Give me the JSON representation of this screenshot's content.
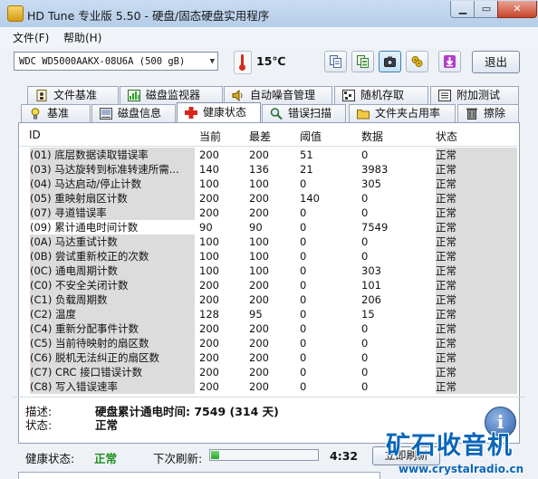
{
  "window": {
    "title": "HD Tune 专业版 5.50 - 硬盘/固态硬盘实用程序"
  },
  "menu": [
    {
      "label": "文件(F)"
    },
    {
      "label": "帮助(H)"
    }
  ],
  "toolbar": {
    "drive": "WDC WD5000AAKX-08U6A (500 gB)",
    "temperature": "15℃",
    "exit_label": "退出",
    "buttons": [
      "copy-icon",
      "copy-text-icon",
      "camera-icon",
      "options-icon",
      "download-icon"
    ]
  },
  "tabs_row1": [
    {
      "label": "文件基准",
      "icon": "file-benchmark-icon"
    },
    {
      "label": "磁盘监视器",
      "icon": "disk-monitor-icon"
    },
    {
      "label": "自动噪音管理",
      "icon": "speaker-icon"
    },
    {
      "label": "随机存取",
      "icon": "random-access-icon"
    },
    {
      "label": "附加测试",
      "icon": "extra-tests-icon"
    }
  ],
  "tabs_row2": [
    {
      "label": "基准",
      "icon": "benchmark-icon"
    },
    {
      "label": "磁盘信息",
      "icon": "disk-info-icon"
    },
    {
      "label": "健康状态",
      "icon": "health-cross-icon"
    },
    {
      "label": "错误扫描",
      "icon": "magnifier-icon"
    },
    {
      "label": "文件夹占用率",
      "icon": "folder-icon"
    },
    {
      "label": "擦除",
      "icon": "trash-icon"
    }
  ],
  "table": {
    "headers": {
      "id": "ID",
      "current": "当前",
      "worst": "最差",
      "threshold": "阈值",
      "data": "数据",
      "status": "状态"
    },
    "rows": [
      {
        "id": "(01) 底层数据读取错误率",
        "current": "200",
        "worst": "200",
        "threshold": "51",
        "data": "0",
        "status": "正常"
      },
      {
        "id": "(03) 马达旋转到标准转速所需...",
        "current": "140",
        "worst": "136",
        "threshold": "21",
        "data": "3983",
        "status": "正常"
      },
      {
        "id": "(04) 马达启动/停止计数",
        "current": "100",
        "worst": "100",
        "threshold": "0",
        "data": "305",
        "status": "正常"
      },
      {
        "id": "(05) 重映射扇区计数",
        "current": "200",
        "worst": "200",
        "threshold": "140",
        "data": "0",
        "status": "正常"
      },
      {
        "id": "(07) 寻道错误率",
        "current": "200",
        "worst": "200",
        "threshold": "0",
        "data": "0",
        "status": "正常"
      },
      {
        "id": "(09) 累计通电时间计数",
        "current": "90",
        "worst": "90",
        "threshold": "0",
        "data": "7549",
        "status": "正常"
      },
      {
        "id": "(0A) 马达重试计数",
        "current": "100",
        "worst": "100",
        "threshold": "0",
        "data": "0",
        "status": "正常"
      },
      {
        "id": "(0B) 尝试重新校正的次数",
        "current": "100",
        "worst": "100",
        "threshold": "0",
        "data": "0",
        "status": "正常"
      },
      {
        "id": "(0C) 通电周期计数",
        "current": "100",
        "worst": "100",
        "threshold": "0",
        "data": "303",
        "status": "正常"
      },
      {
        "id": "(C0) 不安全关闭计数",
        "current": "200",
        "worst": "200",
        "threshold": "0",
        "data": "101",
        "status": "正常"
      },
      {
        "id": "(C1) 负载周期数",
        "current": "200",
        "worst": "200",
        "threshold": "0",
        "data": "206",
        "status": "正常"
      },
      {
        "id": "(C2) 温度",
        "current": "128",
        "worst": "95",
        "threshold": "0",
        "data": "15",
        "status": "正常"
      },
      {
        "id": "(C4) 重新分配事件计数",
        "current": "200",
        "worst": "200",
        "threshold": "0",
        "data": "0",
        "status": "正常"
      },
      {
        "id": "(C5) 当前待映射的扇区数",
        "current": "200",
        "worst": "200",
        "threshold": "0",
        "data": "0",
        "status": "正常"
      },
      {
        "id": "(C6) 脱机无法纠正的扇区数",
        "current": "200",
        "worst": "200",
        "threshold": "0",
        "data": "0",
        "status": "正常"
      },
      {
        "id": "(C7) CRC 接口错误计数",
        "current": "200",
        "worst": "200",
        "threshold": "0",
        "data": "0",
        "status": "正常"
      },
      {
        "id": "(C8) 写入错误速率",
        "current": "200",
        "worst": "200",
        "threshold": "0",
        "data": "0",
        "status": "正常"
      }
    ]
  },
  "details": {
    "desc_label": "描述:",
    "desc_value": "硬盘累计通电时间: 7549 (314 天)",
    "status_label": "状态:",
    "status_value": "正常"
  },
  "footer": {
    "health_label": "健康状态:",
    "health_value": "正常",
    "refresh_label": "下次刷新:",
    "countdown": "4:32",
    "refresh_fraction": 0.08,
    "refresh_button": "立即刷新"
  },
  "watermark": {
    "text": "矿石收音机",
    "url": "www.crystalradio.cn"
  },
  "colors": {
    "accent": "#0a66b8",
    "health_ok": "#1f8f1f"
  }
}
